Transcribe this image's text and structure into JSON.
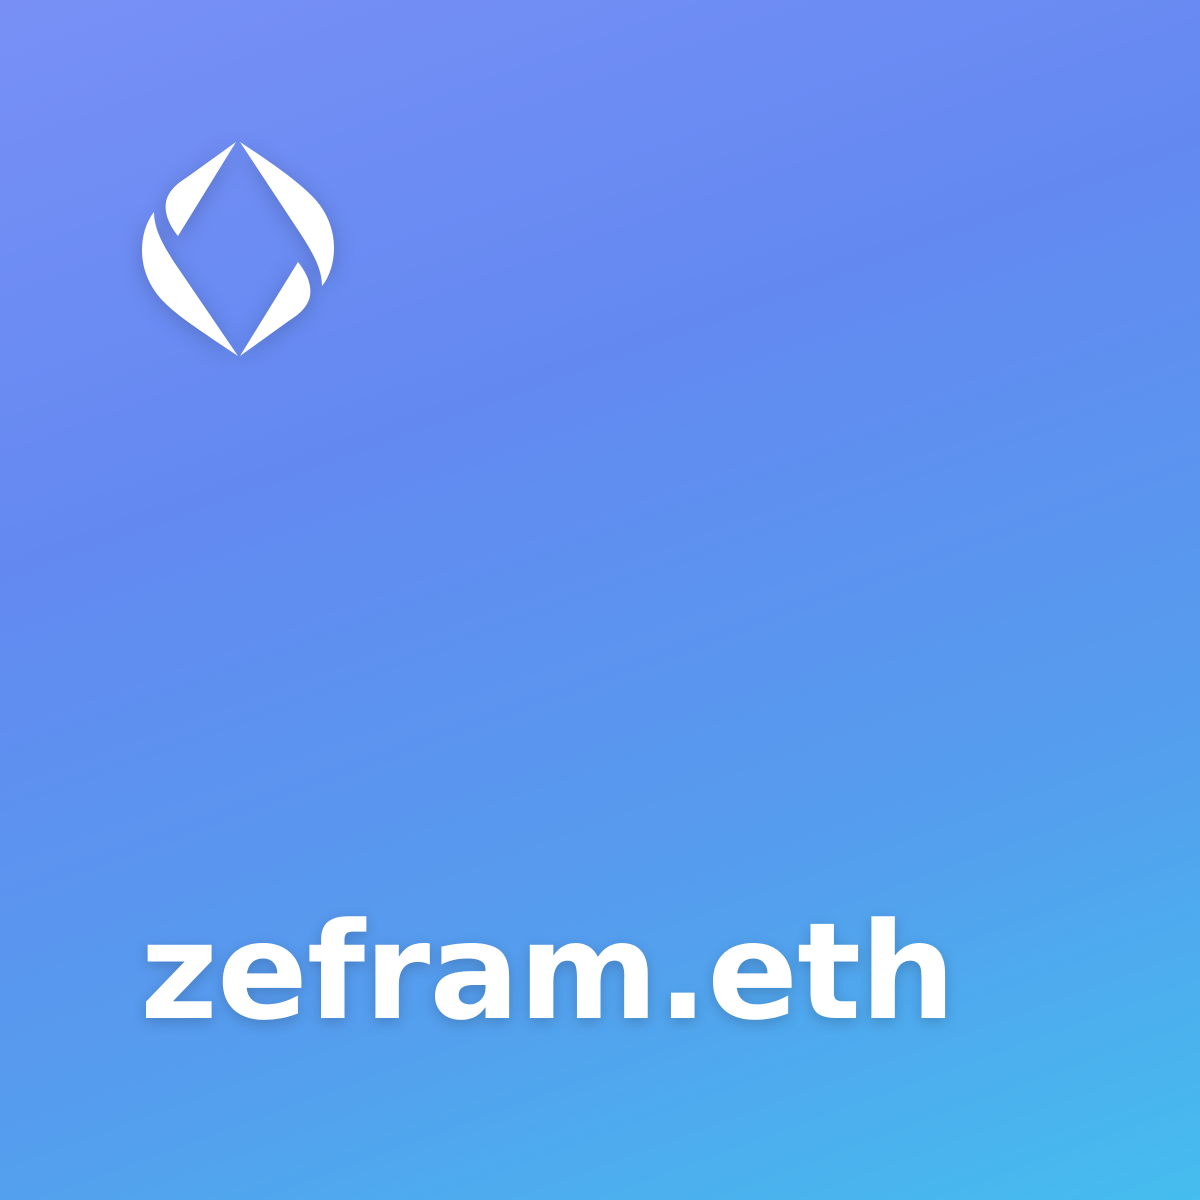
{
  "logo": {
    "icon": "ens-logo-icon",
    "color": "#FFFFFF"
  },
  "domain": {
    "name": "zefram.eth"
  },
  "colors": {
    "gradient_start": "#7890F6",
    "gradient_mid": "#6389F1",
    "gradient_end": "#45BDEE",
    "text": "#FFFFFF"
  }
}
